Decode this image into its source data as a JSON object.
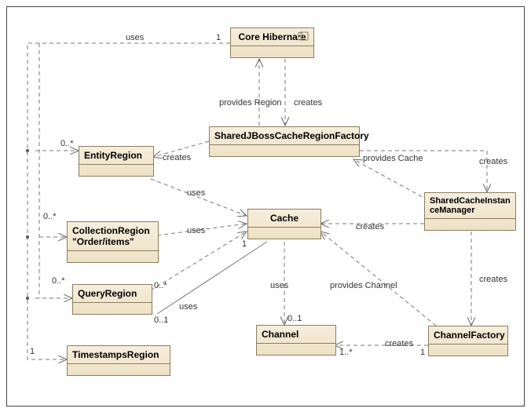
{
  "boxes": {
    "core": {
      "title": "Core Hibernate"
    },
    "factory": {
      "title": "SharedJBossCacheRegionFactory"
    },
    "entity": {
      "title": "EntityRegion"
    },
    "collection": {
      "title": "CollectionRegion\n\"Order/items\""
    },
    "query": {
      "title": "QueryRegion"
    },
    "timestamps": {
      "title": "TimestampsRegion"
    },
    "cache": {
      "title": "Cache"
    },
    "channel": {
      "title": "Channel"
    },
    "channelFactory": {
      "title": "ChannelFactory"
    },
    "manager": {
      "title": "SharedCacheInstanceManager"
    }
  },
  "labels": {
    "uses1": "uses",
    "uses2": "uses",
    "uses3": "uses",
    "uses4": "uses",
    "uses5": "uses",
    "providesRegion": "provides Region",
    "providesCache": "provides Cache",
    "providesChannel": "provides Channel",
    "creates1": "creates",
    "creates2": "creates",
    "creates3": "creates",
    "creates4": "creates",
    "creates5": "creates",
    "creates6": "creates"
  },
  "multiplicities": {
    "core_one": "1",
    "entity_many": "0..*",
    "collection_many": "0..*",
    "query_many": "0..*",
    "timestamps_one": "1",
    "cache_one": "1",
    "query_zero": "0..*",
    "ts_zeroone": "0..1",
    "channel_zeroone": "0..1",
    "channel_oneplus": "1..*",
    "cfactory_one": "1"
  }
}
